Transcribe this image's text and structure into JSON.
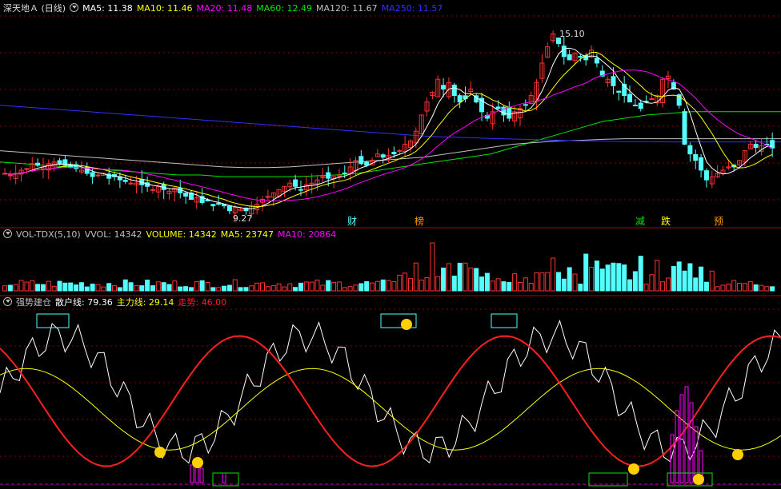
{
  "colors": {
    "up": "#ff3232",
    "down": "#54ffff",
    "ma5": "#ffffff",
    "ma10": "#ffff00",
    "ma20": "#ff00ff",
    "ma60": "#00e600",
    "ma120": "#c0c0c0",
    "ma250": "#3030ff",
    "grid": "#8b0000",
    "sep": "#b00000",
    "dash": "#c000c0"
  },
  "panel1": {
    "title": "深天地Ａ (日线)",
    "legend": [
      {
        "label": "MA5: 11.38",
        "color": "#ffffff"
      },
      {
        "label": "MA10: 11.46",
        "color": "#ffff00"
      },
      {
        "label": "MA20: 11.48",
        "color": "#ff00ff"
      },
      {
        "label": "MA60: 12.49",
        "color": "#00e600"
      },
      {
        "label": "MA120: 11.67",
        "color": "#c0c0c0"
      },
      {
        "label": "MA250: 11.57",
        "color": "#3030ff"
      }
    ],
    "high_label": "15.10",
    "low_label": "9.27",
    "events": [
      {
        "text": "财",
        "color": "#54ffff"
      },
      {
        "text": "榜",
        "color": "#ff9900"
      },
      {
        "text": "减",
        "color": "#00e600"
      },
      {
        "text": "跌",
        "color": "#ffff00"
      },
      {
        "text": "预",
        "color": "#ff9900"
      }
    ]
  },
  "panel2": {
    "legend": [
      {
        "label": "VOL-TDX(5,10)",
        "color": "#c0c0c0"
      },
      {
        "label": "VVOL: 14342",
        "color": "#c0c0c0"
      },
      {
        "label": "VOLUME: 14342",
        "color": "#ffff00"
      },
      {
        "label": "MA5: 23747",
        "color": "#ffff00"
      },
      {
        "label": "MA10: 20864",
        "color": "#ff00ff"
      }
    ]
  },
  "panel3": {
    "legend": [
      {
        "label": "强势建仓",
        "color": "#c0c0c0"
      },
      {
        "label": "散户线: 79.36",
        "color": "#ffffff"
      },
      {
        "label": "主力线: 29.14",
        "color": "#ffff00"
      },
      {
        "label": "走势: 46.00",
        "color": "#ff2020"
      }
    ]
  },
  "chart_data": {
    "type": "candlestick",
    "title": "深天地Ａ (日线)",
    "ylim": [
      9.0,
      15.5
    ],
    "high": 15.1,
    "low": 9.27,
    "closes": [
      10.6,
      10.55,
      10.6,
      10.7,
      10.75,
      10.9,
      10.85,
      10.8,
      10.9,
      10.95,
      10.9,
      10.85,
      10.8,
      10.75,
      10.7,
      10.6,
      10.5,
      10.55,
      10.6,
      10.45,
      10.5,
      10.4,
      10.35,
      10.3,
      10.3,
      10.25,
      10.2,
      10.1,
      10.2,
      10.1,
      10.05,
      10.15,
      10.0,
      9.9,
      9.8,
      9.85,
      9.7,
      9.75,
      9.6,
      9.65,
      9.6,
      9.45,
      9.55,
      9.5,
      9.45,
      9.6,
      9.65,
      9.8,
      9.9,
      10.0,
      10.1,
      10.2,
      10.3,
      10.2,
      10.1,
      10.25,
      10.3,
      10.4,
      10.5,
      10.45,
      10.5,
      10.55,
      10.6,
      10.8,
      11.0,
      10.9,
      10.85,
      11.0,
      11.2,
      11.1,
      11.15,
      11.2,
      11.3,
      11.5,
      11.6,
      11.9,
      12.4,
      12.8,
      13.1,
      13.5,
      13.2,
      13.4,
      13.0,
      12.8,
      12.9,
      13.2,
      12.8,
      12.5,
      12.3,
      12.5,
      12.6,
      12.4,
      12.3,
      12.5,
      12.6,
      12.7,
      13.0,
      13.4,
      14.0,
      14.5,
      14.9,
      14.6,
      14.2,
      14.1,
      14.3,
      14.2,
      14.1,
      14.4,
      14.0,
      13.6,
      13.5,
      13.3,
      13.1,
      13.0,
      12.8,
      12.7,
      12.6,
      12.8,
      12.9,
      13.0,
      13.5,
      13.6,
      13.2,
      12.7,
      11.5,
      11.2,
      11.0,
      10.7,
      10.4,
      10.5,
      10.6,
      10.7,
      10.8,
      10.8,
      11.0,
      11.3,
      11.5,
      11.4,
      11.45,
      11.5,
      11.38
    ],
    "ma60": [
      10.95,
      10.9,
      10.85,
      10.8,
      10.75,
      10.7,
      10.65,
      10.6,
      10.55,
      10.55,
      10.5,
      10.5,
      10.5,
      10.5,
      10.52,
      10.55,
      10.6,
      10.7,
      10.8,
      10.9,
      11.0,
      11.1,
      11.2,
      11.4,
      11.6,
      11.8,
      12.0,
      12.2,
      12.3,
      12.4,
      12.45,
      12.5,
      12.5,
      12.5,
      12.5,
      12.5
    ],
    "ma120": [
      11.3,
      11.25,
      11.2,
      11.15,
      11.1,
      11.05,
      11.0,
      10.95,
      10.9,
      10.85,
      10.8,
      10.78,
      10.78,
      10.8,
      10.85,
      10.9,
      10.95,
      11.0,
      11.05,
      11.1,
      11.2,
      11.3,
      11.4,
      11.5,
      11.55,
      11.6,
      11.62,
      11.65,
      11.67,
      11.67,
      11.67,
      11.67,
      11.67,
      11.67,
      11.67,
      11.67
    ],
    "ma250": [
      12.7,
      12.65,
      12.6,
      12.55,
      12.5,
      12.45,
      12.4,
      12.35,
      12.3,
      12.25,
      12.2,
      12.15,
      12.1,
      12.05,
      12.0,
      11.95,
      11.9,
      11.85,
      11.8,
      11.75,
      11.72,
      11.7,
      11.68,
      11.66,
      11.64,
      11.62,
      11.6,
      11.6,
      11.58,
      11.58,
      11.57,
      11.57,
      11.57,
      11.57,
      11.57,
      11.57
    ],
    "volume": {
      "last": 14342,
      "ma5": 23747,
      "ma10": 20864
    },
    "indicator": {
      "retail": 79.36,
      "main": 29.14,
      "trend": 46.0
    }
  }
}
